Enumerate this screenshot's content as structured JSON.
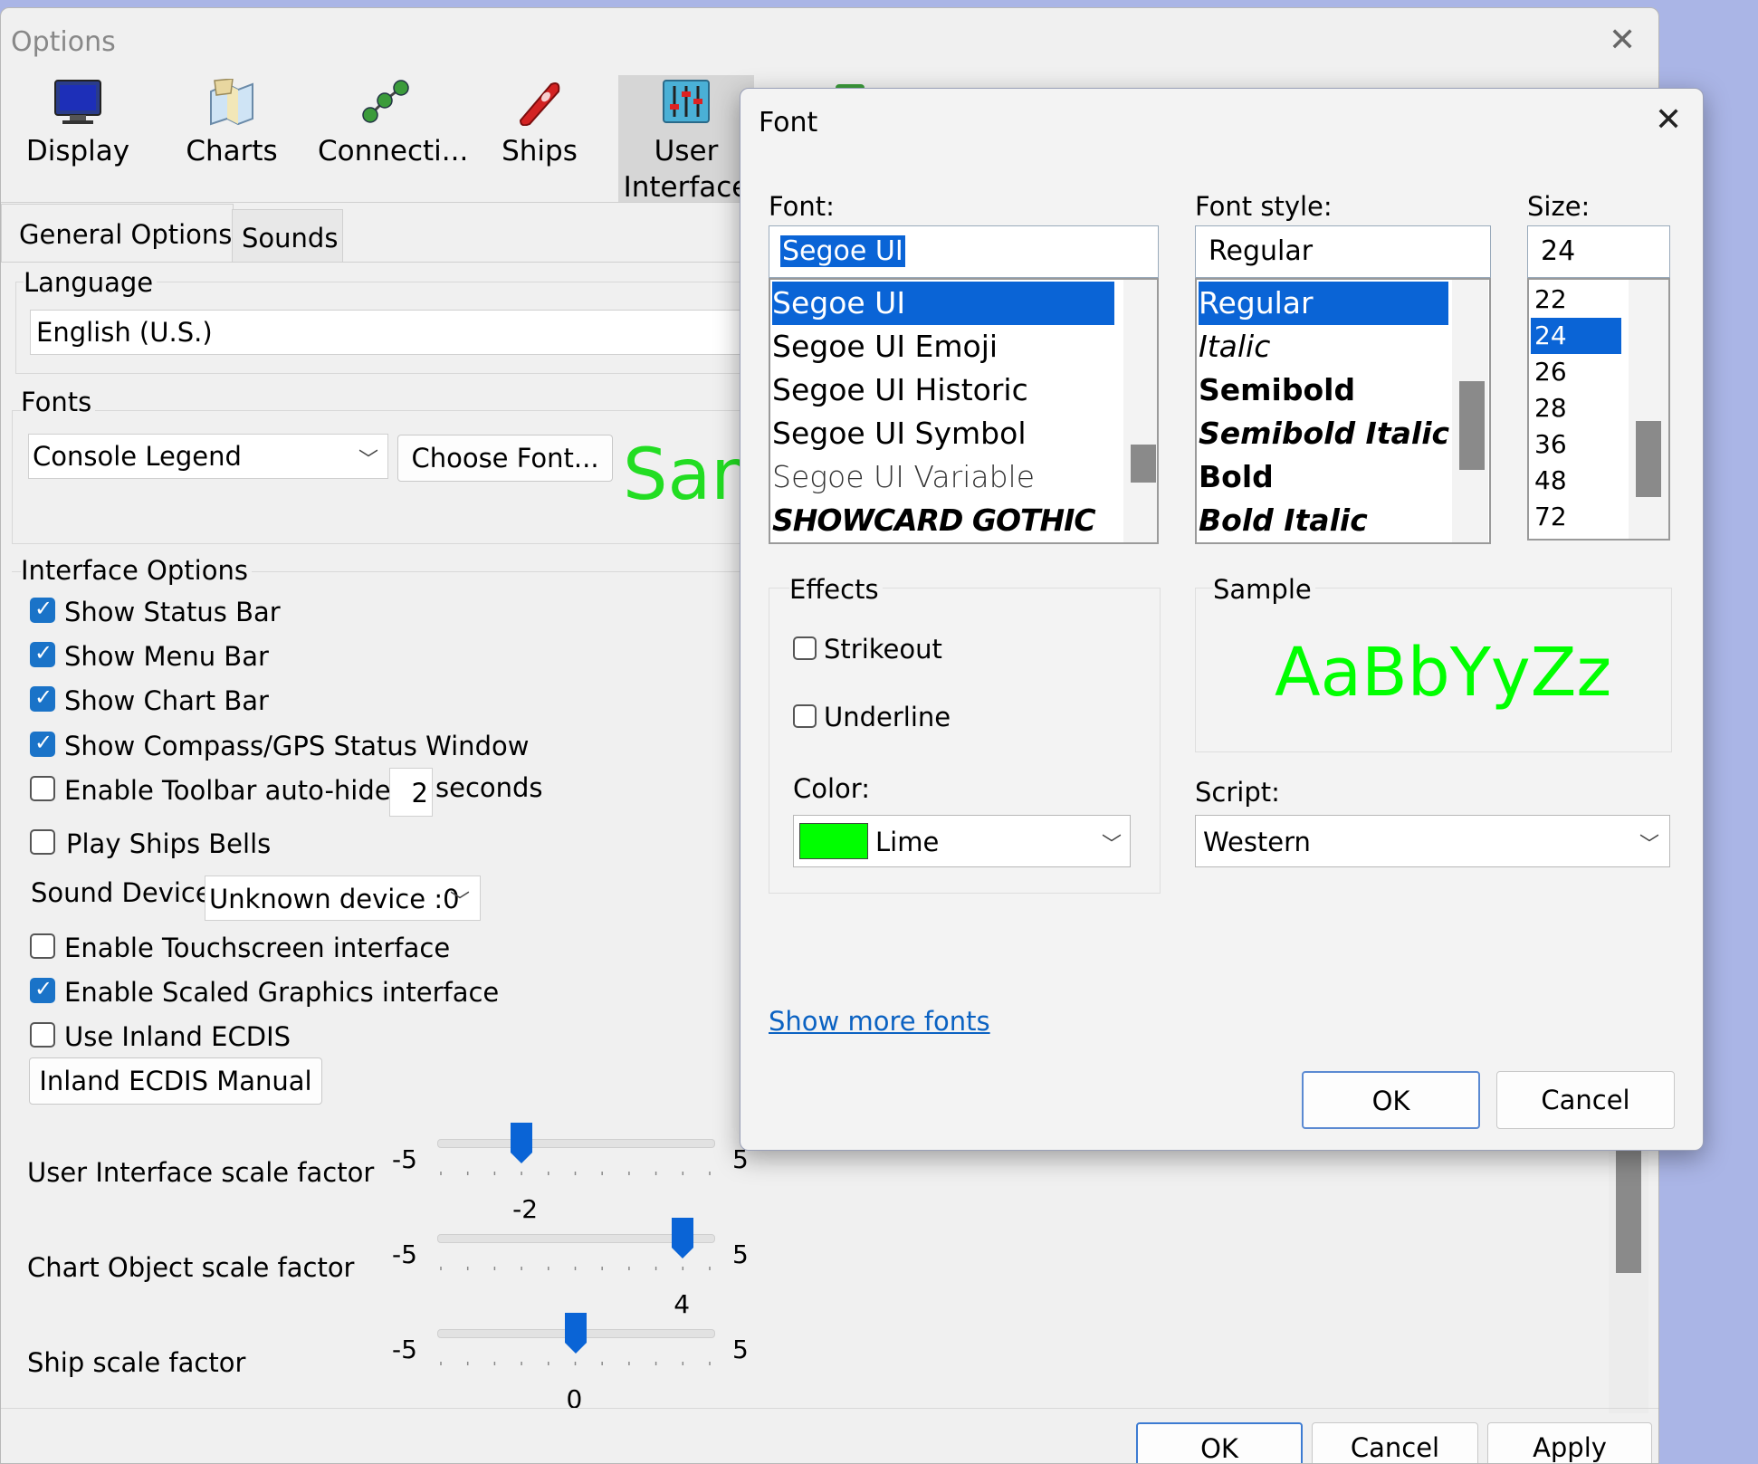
{
  "options": {
    "title": "Options",
    "toolbar": [
      {
        "label": "Display",
        "icon": "monitor-icon"
      },
      {
        "label": "Charts",
        "icon": "charts-icon"
      },
      {
        "label": "Connecti...",
        "icon": "connections-icon"
      },
      {
        "label": "Ships",
        "icon": "ship-icon"
      },
      {
        "label": "User\nInterface",
        "icon": "user-interface-icon"
      }
    ],
    "tabs": [
      "General Options",
      "Sounds"
    ],
    "language": {
      "group": "Language",
      "value": "English (U.S.)"
    },
    "fonts": {
      "group": "Fonts",
      "selected": "Console Legend",
      "choose_button": "Choose Font...",
      "sample_text": "Sam"
    },
    "interface": {
      "group": "Interface Options",
      "checkboxes": [
        {
          "label": "Show Status Bar",
          "checked": true
        },
        {
          "label": "Show Menu Bar",
          "checked": true
        },
        {
          "label": "Show Chart Bar",
          "checked": true
        },
        {
          "label": "Show Compass/GPS Status Window",
          "checked": true
        },
        {
          "label": "Enable Toolbar auto-hide",
          "checked": false
        }
      ],
      "autohide_value": "2",
      "autohide_unit": "seconds",
      "ships_bells": {
        "label": "Play Ships Bells",
        "checked": false
      },
      "sound_device_label": "Sound Device",
      "sound_device_value": "Unknown device :0",
      "checkboxes2": [
        {
          "label": "Enable Touchscreen interface",
          "checked": false
        },
        {
          "label": "Enable Scaled Graphics interface",
          "checked": true
        },
        {
          "label": "Use Inland ECDIS",
          "checked": false
        }
      ],
      "ecdis_button": "Inland ECDIS Manual"
    },
    "sliders": [
      {
        "label": "User Interface scale factor",
        "min": "-5",
        "max": "5",
        "value": -2,
        "value_label": "-2"
      },
      {
        "label": "Chart Object scale factor",
        "min": "-5",
        "max": "5",
        "value": 4,
        "value_label": "4"
      },
      {
        "label": "Ship scale factor",
        "min": "-5",
        "max": "5",
        "value": 0,
        "value_label": "0"
      }
    ],
    "buttons": {
      "ok": "OK",
      "cancel": "Cancel",
      "apply": "Apply"
    }
  },
  "font_dialog": {
    "title": "Font",
    "font_label": "Font:",
    "font_value": "Segoe UI",
    "fonts": [
      "Segoe UI",
      "Segoe UI Emoji",
      "Segoe UI Historic",
      "Segoe UI Symbol",
      "Segoe UI Variable",
      "SHOWCARD GOTHIC"
    ],
    "style_label": "Font style:",
    "style_value": "Regular",
    "styles": [
      "Regular",
      "Italic",
      "Semibold",
      "Semibold Italic",
      "Bold",
      "Bold Italic"
    ],
    "size_label": "Size:",
    "size_value": "24",
    "sizes": [
      "22",
      "24",
      "26",
      "28",
      "36",
      "48",
      "72"
    ],
    "effects": {
      "group": "Effects",
      "strikeout": "Strikeout",
      "underline": "Underline",
      "color_label": "Color:",
      "color_name": "Lime",
      "color_hex": "#00ff00"
    },
    "sample": {
      "group": "Sample",
      "text": "AaBbYyZz"
    },
    "script_label": "Script:",
    "script_value": "Western",
    "show_more": "Show more fonts",
    "ok": "OK",
    "cancel": "Cancel"
  }
}
